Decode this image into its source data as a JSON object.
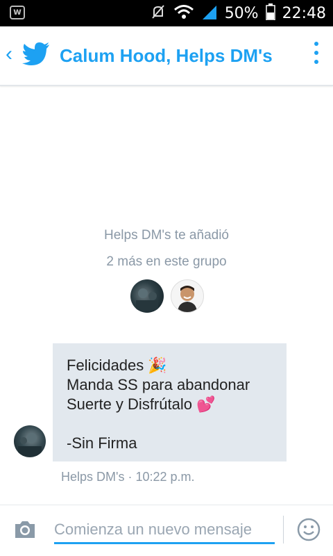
{
  "status_bar": {
    "battery_percent": "50%",
    "time": "22:48",
    "left_icon_letter": "w",
    "icons": [
      "mute-icon",
      "wifi-icon",
      "signal-icon",
      "battery-icon"
    ]
  },
  "header": {
    "title": "Calum Hood, Helps DM's",
    "icons": [
      "back-chevron-icon",
      "twitter-bird-icon",
      "more-vertical-icon"
    ]
  },
  "conversation": {
    "added_line": "Helps DM's te añadió",
    "group_line": "2 más en este grupo",
    "message": {
      "line1": "Felicidades 🎉",
      "line2": "Manda SS para abandonar",
      "line3": "Suerte y Disfrútalo 💕",
      "line4": "-Sin Firma"
    },
    "meta": "Helps DM's · 10:22 p.m."
  },
  "composer": {
    "placeholder": "Comienza un nuevo mensaje",
    "value": ""
  },
  "colors": {
    "accent": "#1da1f2",
    "bubble": "#e2e8ee",
    "muted_text": "#8a98a6"
  }
}
